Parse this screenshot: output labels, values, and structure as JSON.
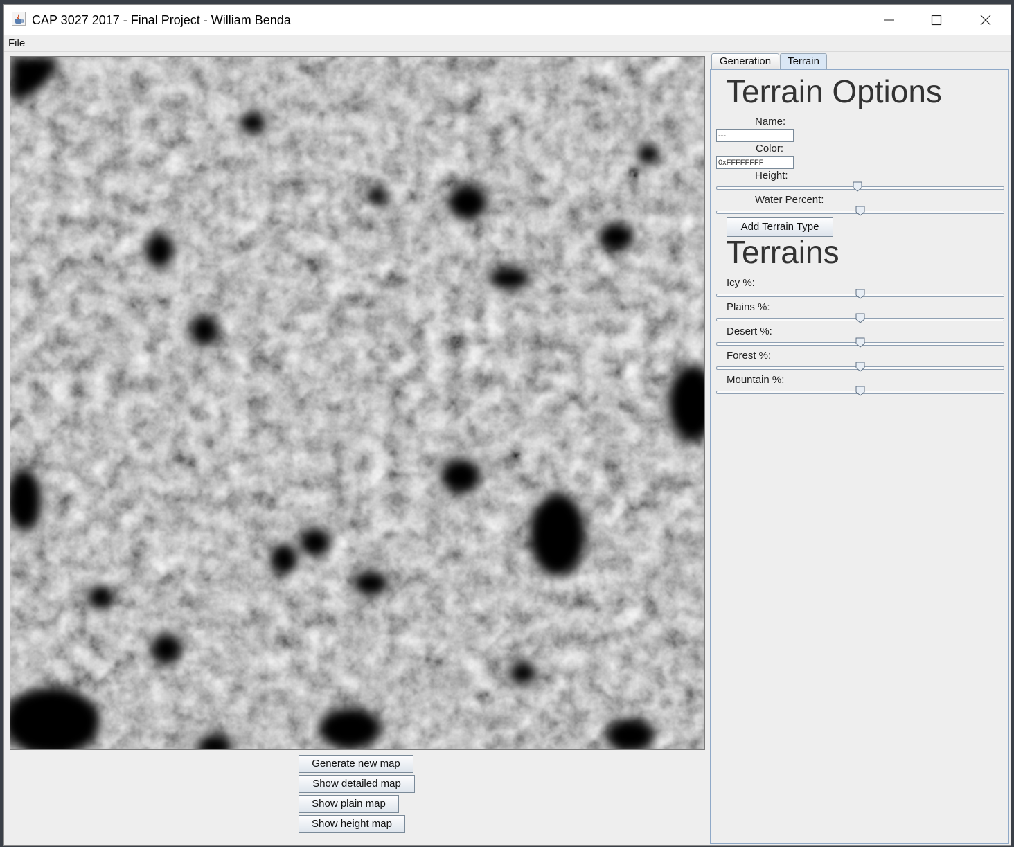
{
  "window": {
    "title": "CAP 3027 2017 - Final Project - William Benda"
  },
  "menu": {
    "file": "File"
  },
  "map": {
    "description_icon": "heightmap-image"
  },
  "buttons": {
    "generate": "Generate new map",
    "detailed": "Show detailed map",
    "plain": "Show plain map",
    "height": "Show height map"
  },
  "tabs": {
    "generation": "Generation",
    "terrain": "Terrain",
    "active": "Terrain"
  },
  "terrain_options": {
    "heading": "Terrain Options",
    "name_label": "Name:",
    "name_value": "---",
    "color_label": "Color:",
    "color_value": "0xFFFFFFFF",
    "height_label": "Height:",
    "height_value": 0.49,
    "water_label": "Water Percent:",
    "water_value": 0.5,
    "add_button": "Add Terrain Type"
  },
  "terrains": {
    "heading": "Terrains",
    "items": [
      {
        "label": "Icy %:",
        "value": 0.5
      },
      {
        "label": "Plains %:",
        "value": 0.5
      },
      {
        "label": "Desert %:",
        "value": 0.5
      },
      {
        "label": "Forest %:",
        "value": 0.5
      },
      {
        "label": "Mountain %:",
        "value": 0.5
      }
    ]
  },
  "colors": {
    "accent": "#dae7f5",
    "panel_border": "#8fa9c8"
  }
}
